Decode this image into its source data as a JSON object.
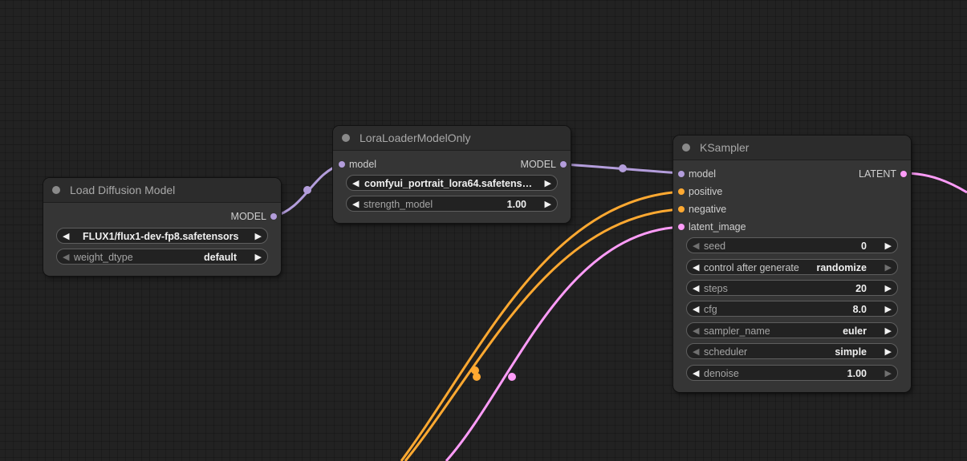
{
  "colors": {
    "model": "#b39ddb",
    "conditioning": "#ffa931",
    "latent": "#ff9cf9",
    "node_bg": "#353535",
    "title_bg": "#2c2c2c",
    "canvas_bg": "#222222"
  },
  "nodes": {
    "load_diffusion": {
      "title": "Load Diffusion Model",
      "outputs": {
        "model": "MODEL"
      },
      "widgets": {
        "unet_name": {
          "value": "FLUX1/flux1-dev-fp8.safetensors"
        },
        "weight_dtype": {
          "label": "weight_dtype",
          "value": "default"
        }
      }
    },
    "lora_loader": {
      "title": "LoraLoaderModelOnly",
      "inputs": {
        "model": "model"
      },
      "outputs": {
        "model": "MODEL"
      },
      "widgets": {
        "lora_name": {
          "value": "comfyui_portrait_lora64.safetens…"
        },
        "strength_model": {
          "label": "strength_model",
          "value": "1.00"
        }
      }
    },
    "ksampler": {
      "title": "KSampler",
      "inputs": {
        "model": "model",
        "positive": "positive",
        "negative": "negative",
        "latent_image": "latent_image"
      },
      "outputs": {
        "latent": "LATENT"
      },
      "widgets": {
        "seed": {
          "label": "seed",
          "value": "0"
        },
        "control_after_generate": {
          "label": "control after generate",
          "value": "randomize"
        },
        "steps": {
          "label": "steps",
          "value": "20"
        },
        "cfg": {
          "label": "cfg",
          "value": "8.0"
        },
        "sampler_name": {
          "label": "sampler_name",
          "value": "euler"
        },
        "scheduler": {
          "label": "scheduler",
          "value": "simple"
        },
        "denoise": {
          "label": "denoise",
          "value": "1.00"
        }
      }
    }
  }
}
